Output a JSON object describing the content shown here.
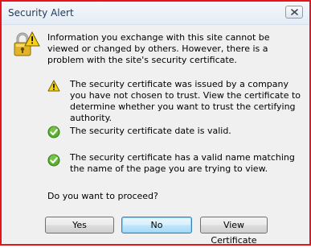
{
  "window": {
    "title": "Security Alert",
    "close_icon": "close-icon",
    "border_color": "#e8141d"
  },
  "intro": "Information you exchange with this site cannot be viewed or changed by others. However, there is a problem with the site's security certificate.",
  "items": [
    {
      "icon": "warning-icon",
      "text": "The security certificate was issued by a company you have not chosen to trust. View the certificate to determine whether you want to trust the certifying authority."
    },
    {
      "icon": "check-icon",
      "text": "The security certificate date is valid."
    },
    {
      "icon": "check-icon",
      "text": "The security certificate has a valid name matching the name of the page you are trying to view."
    }
  ],
  "question": "Do you want to proceed?",
  "buttons": {
    "yes": "Yes",
    "no": "No",
    "view_certificate": "View Certificate"
  }
}
